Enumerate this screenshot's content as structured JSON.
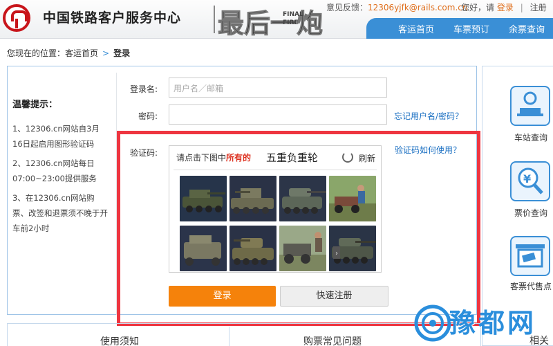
{
  "header": {
    "site_title": "中国铁路客户服务中心",
    "banner_big": "最后一炮",
    "banner_small_1": "FINAL",
    "banner_small_2": "FIRE",
    "feedback_label": "意见反馈：",
    "feedback_email": "12306yjfk@rails.com.cn",
    "greeting": "您好，请",
    "login_link": "登录",
    "register_link": "注册",
    "separator": "|",
    "nav": [
      "客运首页",
      "车票预订",
      "余票查询"
    ]
  },
  "breadcrumb": {
    "prefix": "您现在的位置：",
    "home": "客运首页",
    "arrow": ">",
    "current": "登录"
  },
  "tips": {
    "title": "温馨提示：",
    "items": [
      "1、12306.cn网站自3月16日起启用图形验证码",
      "2、12306.cn网站每日07:00~23:00提供服务",
      "3、在12306.cn网站购票、改签和退票须不晚于开车前2小时"
    ]
  },
  "form": {
    "username_label": "登录名:",
    "username_placeholder": "用户名／邮箱",
    "password_label": "密码:",
    "forgot_link": "忘记用户名/密码？",
    "captcha_label": "验证码:",
    "captcha_help_link": "验证码如何使用？",
    "captcha_instruction_pre": "请点击下图中",
    "captcha_instruction_highlight": "所有的",
    "captcha_words": "五重负重轮",
    "refresh_label": "刷新",
    "login_button": "登录",
    "register_button": "快速注册"
  },
  "sidebar": {
    "items": [
      {
        "label": "车站查询",
        "icon": "train-station-icon"
      },
      {
        "label": "票价查询",
        "icon": "yuan-magnifier-icon"
      },
      {
        "label": "客票代售点",
        "icon": "ticket-agency-icon"
      }
    ]
  },
  "footer_tabs": [
    "使用须知",
    "购票常见问题",
    "相关"
  ],
  "watermark": "豫都网",
  "colors": {
    "accent_blue": "#3a8fd6",
    "login_orange": "#f5820b",
    "highlight_red": "#ee3540",
    "logo_red": "#c8151b"
  }
}
